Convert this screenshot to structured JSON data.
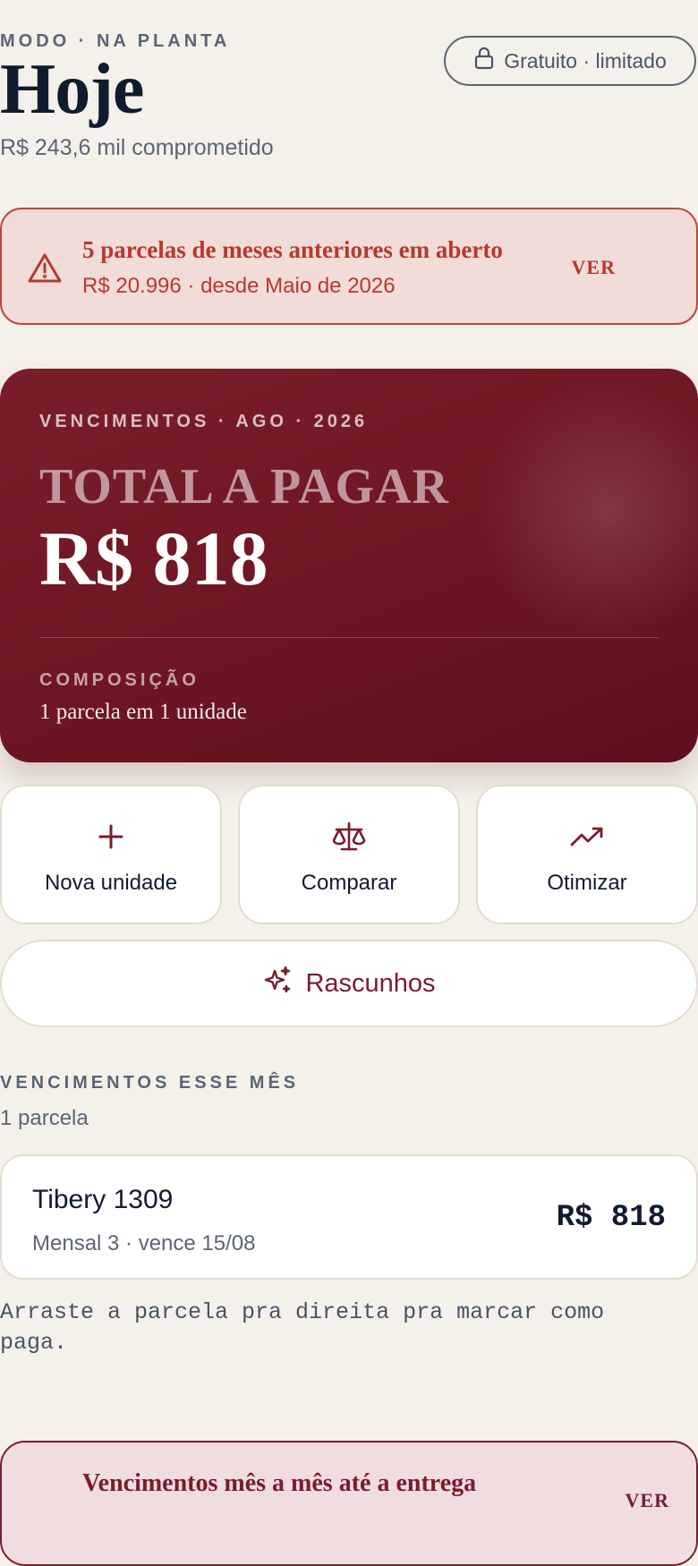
{
  "header": {
    "mode_label": "MODO · NA PLANTA",
    "title": "Hoje",
    "committed": "R$ 243,6 mil comprometido",
    "plan_badge": "Gratuito · limitado"
  },
  "alert": {
    "title": "5 parcelas de meses anteriores em aberto",
    "subtitle": "R$ 20.996 · desde Maio de 2026",
    "action": "VER"
  },
  "hero": {
    "eyebrow": "VENCIMENTOS · AGO · 2026",
    "label": "TOTAL A PAGAR",
    "amount": "R$ 818",
    "composition_label": "COMPOSIÇÃO",
    "composition_value": "1 parcela em 1 unidade"
  },
  "actions": [
    {
      "label": "Nova unidade",
      "icon": "plus-icon"
    },
    {
      "label": "Comparar",
      "icon": "scale-icon"
    },
    {
      "label": "Otimizar",
      "icon": "trending-up-icon"
    }
  ],
  "drafts": {
    "label": "Rascunhos",
    "icon": "sparkles-icon"
  },
  "this_month": {
    "label": "VENCIMENTOS ESSE MÊS",
    "count": "1 parcela",
    "items": [
      {
        "name": "Tibery 1309",
        "detail": "Mensal 3 · vence 15/08",
        "amount": "R$ 818"
      }
    ],
    "hint": "Arraste a parcela pra direita pra marcar como paga."
  },
  "bottom_card": {
    "title": "Vencimentos mês a mês até a entrega",
    "action": "VER"
  },
  "colors": {
    "background": "#f4f1ea",
    "brand": "#7a1d2b",
    "alert": "#b53a2f",
    "text": "#101b2e",
    "muted": "#5b6575"
  }
}
